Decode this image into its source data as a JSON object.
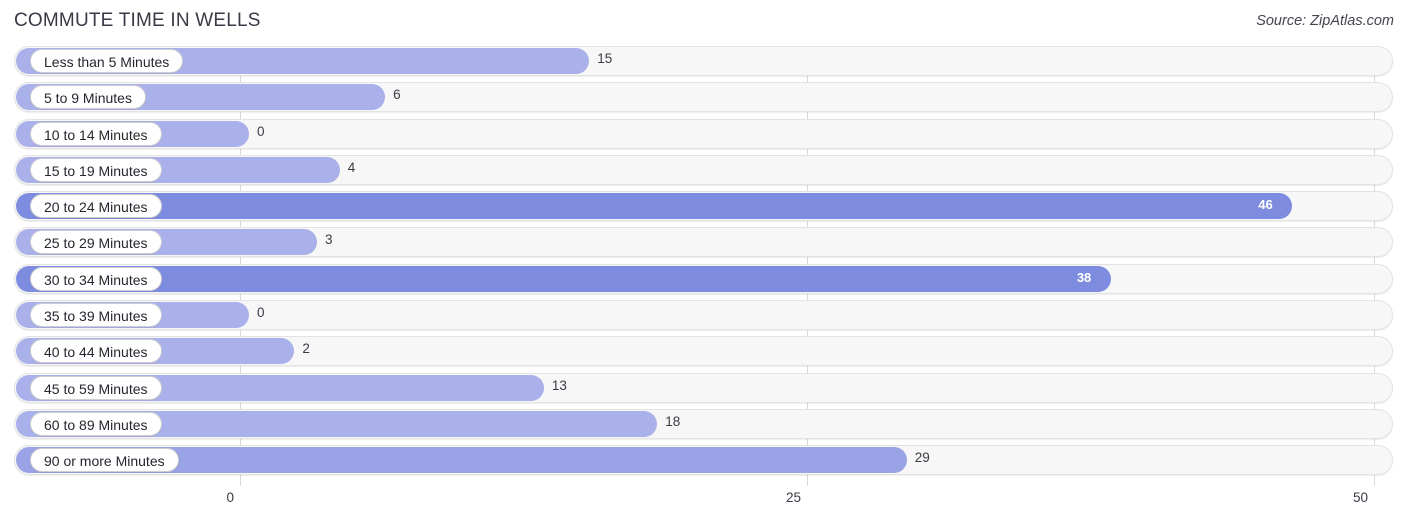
{
  "header": {
    "title": "COMMUTE TIME IN WELLS",
    "source": "Source: ZipAtlas.com"
  },
  "colors": {
    "bar_light": "#aab0ea",
    "bar_dark": "#7e8cdf",
    "track": "#f7f7f7",
    "gridline": "#d8d8d8",
    "text": "#3b3b46"
  },
  "chart_data": {
    "type": "bar",
    "orientation": "horizontal",
    "title": "COMMUTE TIME IN WELLS",
    "xlabel": "",
    "ylabel": "",
    "xlim": [
      0,
      50
    ],
    "grid": true,
    "legend": "none",
    "xticks": [
      "0",
      "25",
      "50"
    ],
    "xtick_values": [
      0,
      25,
      50
    ],
    "categories": [
      "Less than 5 Minutes",
      "5 to 9 Minutes",
      "10 to 14 Minutes",
      "15 to 19 Minutes",
      "20 to 24 Minutes",
      "25 to 29 Minutes",
      "30 to 34 Minutes",
      "35 to 39 Minutes",
      "40 to 44 Minutes",
      "45 to 59 Minutes",
      "60 to 89 Minutes",
      "90 or more Minutes"
    ],
    "values": [
      15,
      6,
      0,
      4,
      46,
      3,
      38,
      0,
      2,
      13,
      18,
      29
    ],
    "labels": [
      "15",
      "6",
      "0",
      "4",
      "46",
      "3",
      "38",
      "0",
      "2",
      "13",
      "18",
      "29"
    ]
  },
  "rows": [
    {
      "label": "Less than 5 Minutes",
      "value": 15,
      "text": "15",
      "inside": false
    },
    {
      "label": "5 to 9 Minutes",
      "value": 6,
      "text": "6",
      "inside": false
    },
    {
      "label": "10 to 14 Minutes",
      "value": 0,
      "text": "0",
      "inside": false
    },
    {
      "label": "15 to 19 Minutes",
      "value": 4,
      "text": "4",
      "inside": false
    },
    {
      "label": "20 to 24 Minutes",
      "value": 46,
      "text": "46",
      "inside": true
    },
    {
      "label": "25 to 29 Minutes",
      "value": 3,
      "text": "3",
      "inside": false
    },
    {
      "label": "30 to 34 Minutes",
      "value": 38,
      "text": "38",
      "inside": true
    },
    {
      "label": "35 to 39 Minutes",
      "value": 0,
      "text": "0",
      "inside": false
    },
    {
      "label": "40 to 44 Minutes",
      "value": 2,
      "text": "2",
      "inside": false
    },
    {
      "label": "45 to 59 Minutes",
      "value": 13,
      "text": "13",
      "inside": false
    },
    {
      "label": "60 to 89 Minutes",
      "value": 18,
      "text": "18",
      "inside": false
    },
    {
      "label": "90 or more Minutes",
      "value": 29,
      "text": "29",
      "inside": false
    }
  ]
}
